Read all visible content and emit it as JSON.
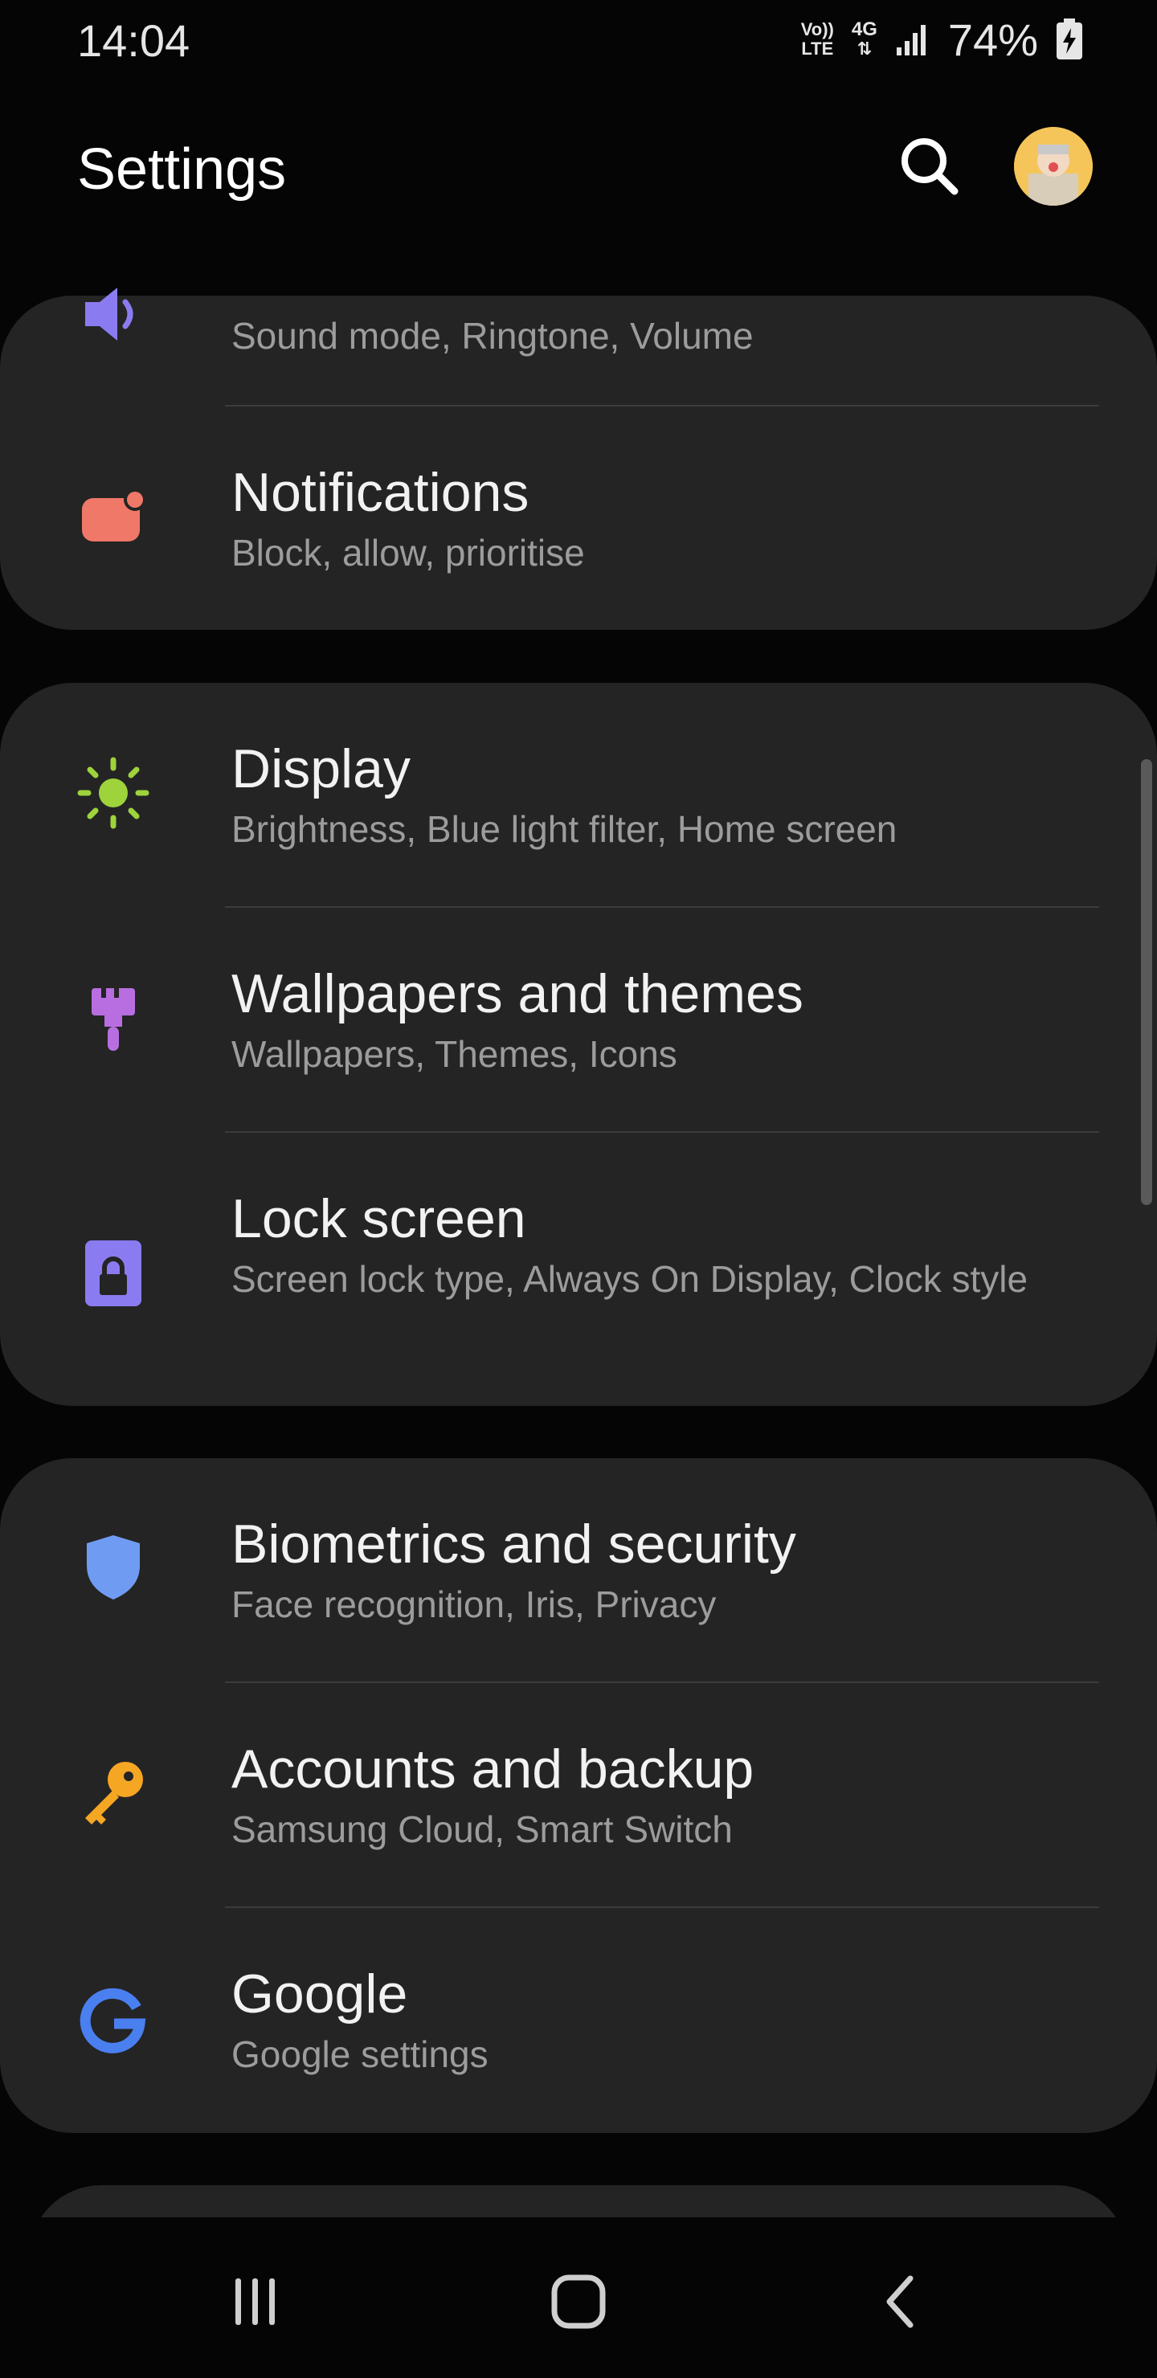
{
  "status_bar": {
    "time": "14:04",
    "volte_top": "Vo))",
    "volte_bottom": "LTE",
    "network": "4G",
    "battery_percent": "74%"
  },
  "header": {
    "title": "Settings"
  },
  "items": [
    {
      "title": "",
      "subtitle": "Sound mode, Ringtone, Volume",
      "icon": "sound-icon",
      "color": "#8a7cf0"
    },
    {
      "title": "Notifications",
      "subtitle": "Block, allow, prioritise",
      "icon": "notifications-icon",
      "color": "#f07868"
    },
    {
      "title": "Display",
      "subtitle": "Brightness, Blue light filter, Home screen",
      "icon": "display-brightness-icon",
      "color": "#9ed33c"
    },
    {
      "title": "Wallpapers and themes",
      "subtitle": "Wallpapers, Themes, Icons",
      "icon": "brush-icon",
      "color": "#b86ee0"
    },
    {
      "title": "Lock screen",
      "subtitle": "Screen lock type, Always On Display, Clock style",
      "icon": "lock-icon",
      "color": "#8a7cf0"
    },
    {
      "title": "Biometrics and security",
      "subtitle": "Face recognition, Iris, Privacy",
      "icon": "shield-icon",
      "color": "#6f9cf2"
    },
    {
      "title": "Accounts and backup",
      "subtitle": "Samsung Cloud, Smart Switch",
      "icon": "key-icon",
      "color": "#f5a623"
    },
    {
      "title": "Google",
      "subtitle": "Google settings",
      "icon": "google-icon",
      "color": "#4a7ff0"
    }
  ],
  "nav": {
    "recents": "recents-icon",
    "home": "home-icon",
    "back": "back-icon"
  }
}
